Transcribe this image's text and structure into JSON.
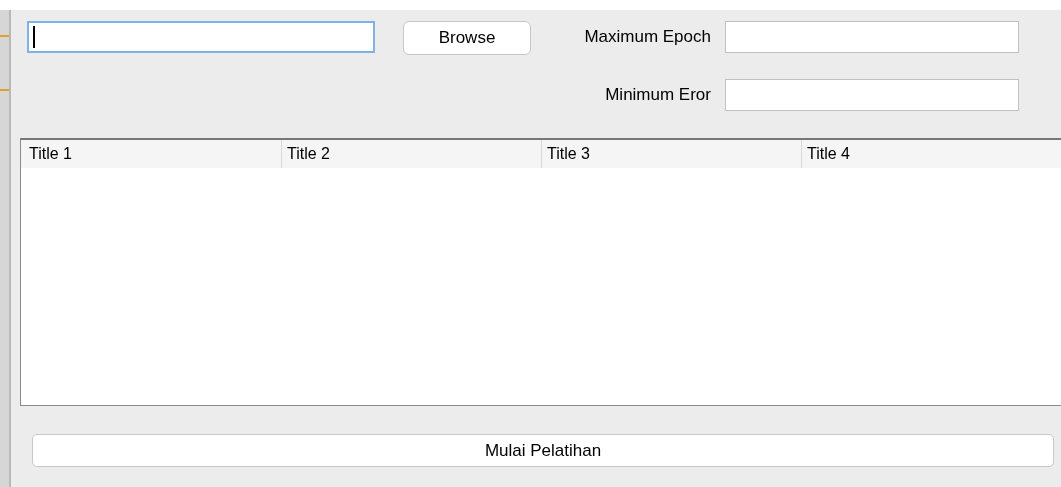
{
  "file_field": {
    "focused": true
  },
  "browse_button": {
    "label": "Browse"
  },
  "parameters": [
    {
      "label": "Maximum Epoch",
      "focused": false
    },
    {
      "label": "Minimum Eror",
      "focused": false
    }
  ],
  "table": {
    "columns": [
      "Title 1",
      "Title 2",
      "Title 3",
      "Title 4"
    ]
  },
  "start_button": {
    "label": "Mulai Pelatihan"
  }
}
